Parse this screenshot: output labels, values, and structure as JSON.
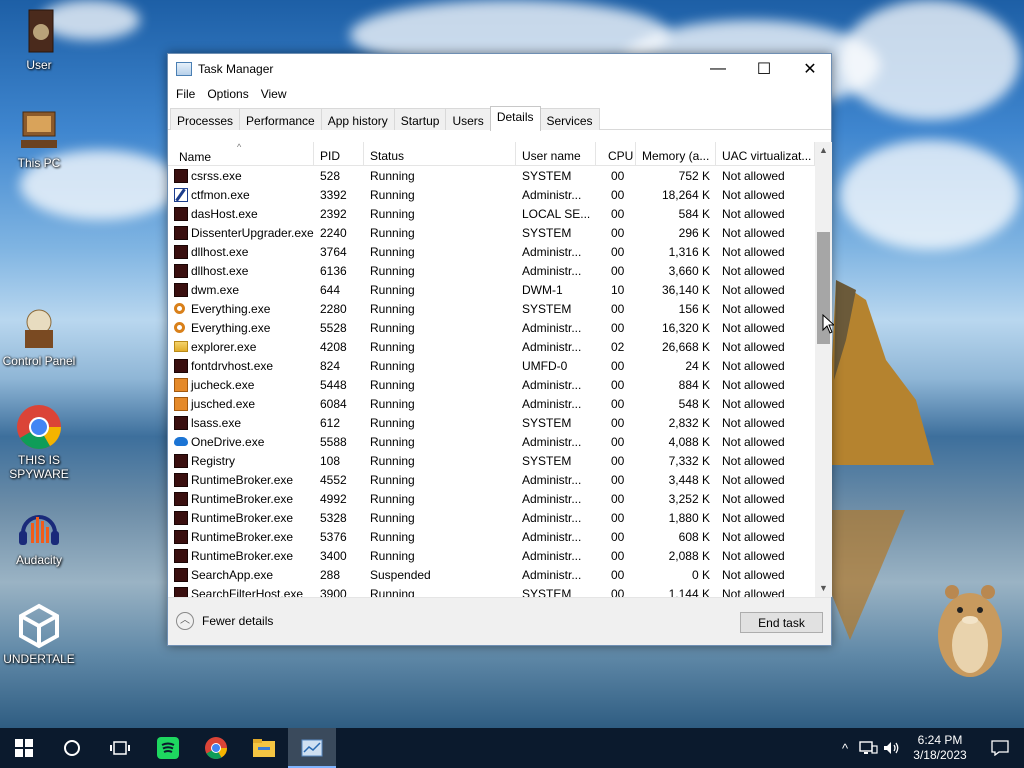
{
  "desktop": {
    "icons": [
      {
        "label": "User"
      },
      {
        "label": "This PC"
      },
      {
        "label": "Control Panel"
      },
      {
        "label": "THIS IS SPYWARE"
      },
      {
        "label": "Audacity"
      },
      {
        "label": "UNDERTALE"
      }
    ]
  },
  "window": {
    "title": "Task Manager",
    "controls": {
      "minimize": "—",
      "maximize": "☐",
      "close": "✕"
    },
    "menu": [
      "File",
      "Options",
      "View"
    ],
    "tabs": [
      {
        "label": "Processes"
      },
      {
        "label": "Performance"
      },
      {
        "label": "App history"
      },
      {
        "label": "Startup"
      },
      {
        "label": "Users"
      },
      {
        "label": "Details",
        "active": true
      },
      {
        "label": "Services"
      }
    ],
    "columns": [
      "Name",
      "PID",
      "Status",
      "User name",
      "CPU",
      "Memory (a...",
      "UAC virtualizat..."
    ],
    "rows": [
      {
        "icon": "proc",
        "name": "csrss.exe",
        "pid": "528",
        "status": "Running",
        "user": "SYSTEM",
        "cpu": "00",
        "mem": "752 K",
        "uac": "Not allowed"
      },
      {
        "icon": "edit",
        "name": "ctfmon.exe",
        "pid": "3392",
        "status": "Running",
        "user": "Administr...",
        "cpu": "00",
        "mem": "18,264 K",
        "uac": "Not allowed"
      },
      {
        "icon": "proc",
        "name": "dasHost.exe",
        "pid": "2392",
        "status": "Running",
        "user": "LOCAL SE...",
        "cpu": "00",
        "mem": "584 K",
        "uac": "Not allowed"
      },
      {
        "icon": "proc",
        "name": "DissenterUpgrader.exe",
        "pid": "2240",
        "status": "Running",
        "user": "SYSTEM",
        "cpu": "00",
        "mem": "296 K",
        "uac": "Not allowed"
      },
      {
        "icon": "proc",
        "name": "dllhost.exe",
        "pid": "3764",
        "status": "Running",
        "user": "Administr...",
        "cpu": "00",
        "mem": "1,316 K",
        "uac": "Not allowed"
      },
      {
        "icon": "proc",
        "name": "dllhost.exe",
        "pid": "6136",
        "status": "Running",
        "user": "Administr...",
        "cpu": "00",
        "mem": "3,660 K",
        "uac": "Not allowed"
      },
      {
        "icon": "proc",
        "name": "dwm.exe",
        "pid": "644",
        "status": "Running",
        "user": "DWM-1",
        "cpu": "10",
        "mem": "36,140 K",
        "uac": "Not allowed"
      },
      {
        "icon": "key",
        "name": "Everything.exe",
        "pid": "2280",
        "status": "Running",
        "user": "SYSTEM",
        "cpu": "00",
        "mem": "156 K",
        "uac": "Not allowed"
      },
      {
        "icon": "key",
        "name": "Everything.exe",
        "pid": "5528",
        "status": "Running",
        "user": "Administr...",
        "cpu": "00",
        "mem": "16,320 K",
        "uac": "Not allowed"
      },
      {
        "icon": "folder",
        "name": "explorer.exe",
        "pid": "4208",
        "status": "Running",
        "user": "Administr...",
        "cpu": "02",
        "mem": "26,668 K",
        "uac": "Not allowed"
      },
      {
        "icon": "proc",
        "name": "fontdrvhost.exe",
        "pid": "824",
        "status": "Running",
        "user": "UMFD-0",
        "cpu": "00",
        "mem": "24 K",
        "uac": "Not allowed"
      },
      {
        "icon": "java",
        "name": "jucheck.exe",
        "pid": "5448",
        "status": "Running",
        "user": "Administr...",
        "cpu": "00",
        "mem": "884 K",
        "uac": "Not allowed"
      },
      {
        "icon": "java",
        "name": "jusched.exe",
        "pid": "6084",
        "status": "Running",
        "user": "Administr...",
        "cpu": "00",
        "mem": "548 K",
        "uac": "Not allowed"
      },
      {
        "icon": "proc",
        "name": "lsass.exe",
        "pid": "612",
        "status": "Running",
        "user": "SYSTEM",
        "cpu": "00",
        "mem": "2,832 K",
        "uac": "Not allowed"
      },
      {
        "icon": "cloud2",
        "name": "OneDrive.exe",
        "pid": "5588",
        "status": "Running",
        "user": "Administr...",
        "cpu": "00",
        "mem": "4,088 K",
        "uac": "Not allowed"
      },
      {
        "icon": "proc",
        "name": "Registry",
        "pid": "108",
        "status": "Running",
        "user": "SYSTEM",
        "cpu": "00",
        "mem": "7,332 K",
        "uac": "Not allowed"
      },
      {
        "icon": "proc",
        "name": "RuntimeBroker.exe",
        "pid": "4552",
        "status": "Running",
        "user": "Administr...",
        "cpu": "00",
        "mem": "3,448 K",
        "uac": "Not allowed"
      },
      {
        "icon": "proc",
        "name": "RuntimeBroker.exe",
        "pid": "4992",
        "status": "Running",
        "user": "Administr...",
        "cpu": "00",
        "mem": "3,252 K",
        "uac": "Not allowed"
      },
      {
        "icon": "proc",
        "name": "RuntimeBroker.exe",
        "pid": "5328",
        "status": "Running",
        "user": "Administr...",
        "cpu": "00",
        "mem": "1,880 K",
        "uac": "Not allowed"
      },
      {
        "icon": "proc",
        "name": "RuntimeBroker.exe",
        "pid": "5376",
        "status": "Running",
        "user": "Administr...",
        "cpu": "00",
        "mem": "608 K",
        "uac": "Not allowed"
      },
      {
        "icon": "proc",
        "name": "RuntimeBroker.exe",
        "pid": "3400",
        "status": "Running",
        "user": "Administr...",
        "cpu": "00",
        "mem": "2,088 K",
        "uac": "Not allowed"
      },
      {
        "icon": "proc",
        "name": "SearchApp.exe",
        "pid": "288",
        "status": "Suspended",
        "user": "Administr...",
        "cpu": "00",
        "mem": "0 K",
        "uac": "Not allowed"
      },
      {
        "icon": "proc",
        "name": "SearchFilterHost.exe",
        "pid": "3900",
        "status": "Running",
        "user": "SYSTEM",
        "cpu": "00",
        "mem": "1,144 K",
        "uac": "Not allowed"
      }
    ],
    "footer": {
      "fewer_details": "Fewer details",
      "end_task": "End task"
    }
  },
  "taskbar": {
    "items": [
      "start-icon",
      "search-icon",
      "task-view-icon",
      "spotify-icon",
      "chrome-icon",
      "file-explorer-icon",
      "task-manager-icon"
    ],
    "clock": {
      "time": "6:24 PM",
      "date": "3/18/2023"
    },
    "tray_chevron": "^"
  }
}
